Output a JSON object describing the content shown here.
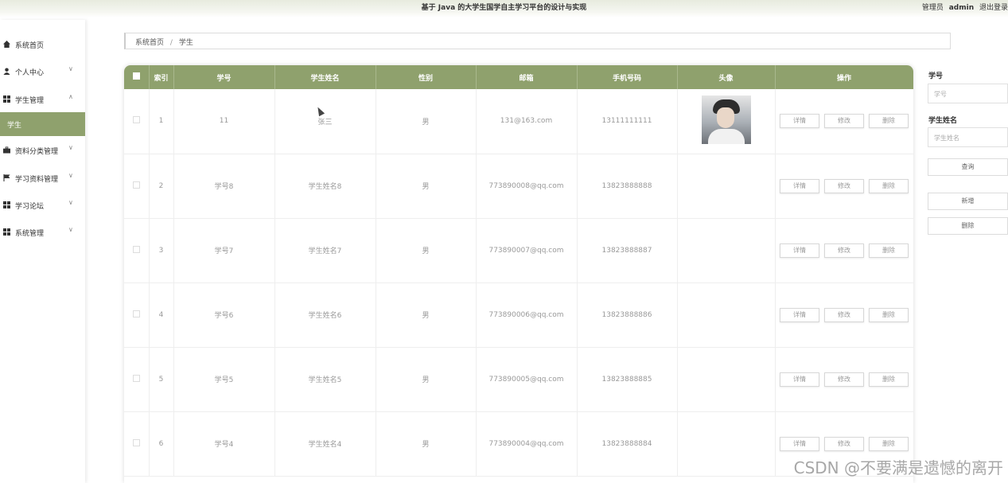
{
  "header": {
    "title": "基于 Java 的大学生国学自主学习平台的设计与实现",
    "user_prefix": "管理员",
    "username": "admin",
    "logout": "退出登录"
  },
  "sidebar": {
    "items": [
      {
        "label": "系统首页",
        "icon": "home-icon"
      },
      {
        "label": "个人中心",
        "icon": "user-icon",
        "chevron": "∨"
      },
      {
        "label": "学生管理",
        "icon": "grid-icon",
        "chevron": "∧"
      },
      {
        "label": "学生",
        "active": true
      },
      {
        "label": "资料分类管理",
        "icon": "briefcase-icon",
        "chevron": "∨"
      },
      {
        "label": "学习资料管理",
        "icon": "flag-icon",
        "chevron": "∨"
      },
      {
        "label": "学习论坛",
        "icon": "grid-icon",
        "chevron": "∨"
      },
      {
        "label": "系统管理",
        "icon": "grid-icon",
        "chevron": "∨"
      }
    ]
  },
  "breadcrumb": {
    "home": "系统首页",
    "separator": "/",
    "current": "学生"
  },
  "table": {
    "headers": [
      "索引",
      "学号",
      "学生姓名",
      "性别",
      "邮箱",
      "手机号码",
      "头像",
      "操作"
    ],
    "rows": [
      {
        "index": "1",
        "student_no": "11",
        "name": "张三",
        "gender": "男",
        "email": "131@163.com",
        "phone": "13111111111",
        "has_avatar": true
      },
      {
        "index": "2",
        "student_no": "学号8",
        "name": "学生姓名8",
        "gender": "男",
        "email": "773890008@qq.com",
        "phone": "13823888888",
        "has_avatar": false
      },
      {
        "index": "3",
        "student_no": "学号7",
        "name": "学生姓名7",
        "gender": "男",
        "email": "773890007@qq.com",
        "phone": "13823888887",
        "has_avatar": false
      },
      {
        "index": "4",
        "student_no": "学号6",
        "name": "学生姓名6",
        "gender": "男",
        "email": "773890006@qq.com",
        "phone": "13823888886",
        "has_avatar": false
      },
      {
        "index": "5",
        "student_no": "学号5",
        "name": "学生姓名5",
        "gender": "男",
        "email": "773890005@qq.com",
        "phone": "13823888885",
        "has_avatar": false
      },
      {
        "index": "6",
        "student_no": "学号4",
        "name": "学生姓名4",
        "gender": "男",
        "email": "773890004@qq.com",
        "phone": "13823888884",
        "has_avatar": false
      }
    ],
    "actions": {
      "detail": "详情",
      "edit": "修改",
      "delete": "删除"
    }
  },
  "search": {
    "student_no_label": "学号",
    "student_no_placeholder": "学号",
    "name_label": "学生姓名",
    "name_placeholder": "学生姓名",
    "query_button": "查询",
    "add_button": "新增",
    "delete_button": "删除"
  },
  "watermark": "CSDN @不要满是遗憾的离开",
  "colors": {
    "accent": "#8fa16d",
    "topbar": "#e7ebde"
  }
}
